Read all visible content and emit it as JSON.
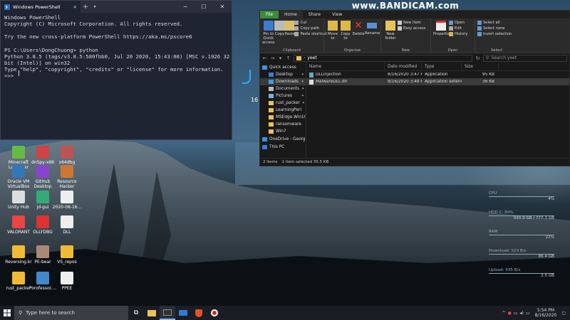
{
  "watermark": {
    "prefix": "www.",
    "brand": "BANDICAM",
    ".suffix": ".com",
    "suffix": ".com"
  },
  "powershell": {
    "tab_title": "Windows PowerShell",
    "new_tab": "+",
    "lines": [
      "Windows PowerShell",
      "Copyright (C) Microsoft Corporation. All rights reserved.",
      "",
      "Try the new cross-platform PowerShell https://aka.ms/pscore6",
      "",
      "PS C:\\Users\\DongChuong> python",
      "Python 3.8.5 (tags/v3.8.5:580fbb0, Jul 20 2020, 15:43:08) [MSC v.1926 32",
      "bit (Intel)] on win32",
      "Type \"help\", \"copyright\", \"credits\" or \"license\" for more information.",
      ">>> "
    ]
  },
  "explorer": {
    "ribbon_tabs": [
      "File",
      "Home",
      "Share",
      "View"
    ],
    "clipboard": {
      "pin": "Pin to Quick access",
      "copy": "Copy",
      "paste": "Paste",
      "cut": "Cut",
      "copy_path": "Copy path",
      "paste_shortcut": "Paste shortcut",
      "label": "Clipboard"
    },
    "organize": {
      "move_to": "Move to",
      "copy_to": "Copy to",
      "delete": "Delete",
      "rename": "Rename",
      "label": "Organize"
    },
    "new": {
      "new_folder": "New folder",
      "new_item": "New item",
      "easy_access": "Easy access",
      "label": "New"
    },
    "open": {
      "properties": "Properties",
      "open": "Open",
      "edit": "Edit",
      "history": "History",
      "label": "Open"
    },
    "select": {
      "select_all": "Select all",
      "select_none": "Select none",
      "invert": "Invert selection",
      "label": "Select"
    },
    "path": "yeet",
    "search_placeholder": "Search yeet",
    "nav": [
      {
        "label": "Quick access",
        "pin": false
      },
      {
        "label": "Desktop",
        "pin": true
      },
      {
        "label": "Downloads",
        "pin": true
      },
      {
        "label": "Documents",
        "pin": true
      },
      {
        "label": "Pictures",
        "pin": true
      },
      {
        "label": "rust_packer",
        "pin": true
      },
      {
        "label": "LearningPerl",
        "pin": false
      },
      {
        "label": "MSEdge.Win10.V",
        "pin": false
      },
      {
        "label": "ransomware",
        "pin": false
      },
      {
        "label": "Win7",
        "pin": false
      },
      {
        "label": "OneDrive - Georg",
        "pin": false
      },
      {
        "label": "This PC",
        "pin": false
      }
    ],
    "columns": [
      "Name",
      "Date modified",
      "Type",
      "Size"
    ],
    "files": [
      {
        "name": "DLLInjection",
        "date": "8/16/2020 3:47 PM",
        "type": "Application",
        "size": "95 KB",
        "selected": false
      },
      {
        "name": "MalwareDLL.dll",
        "date": "8/16/2020 3:49 PM",
        "type": "Application extensi...",
        "size": "36 KB",
        "selected": true
      }
    ],
    "status": {
      "items": "2 items",
      "selected": "1 item selected  35.5 KB"
    }
  },
  "desktop_icons": [
    {
      "label": "Minecraft Launcher",
      "color": "#6b4"
    },
    {
      "label": "dnSpy-x86",
      "color": "#c44"
    },
    {
      "label": "x64dbg",
      "color": "#b55"
    },
    {
      "label": "Oracle VM VirtualBox",
      "color": "#37b"
    },
    {
      "label": "GitHub Desktop",
      "color": "#84c"
    },
    {
      "label": "Resource Hacker",
      "color": "#c73"
    },
    {
      "label": "Unity Hub",
      "color": "#ddd"
    },
    {
      "label": "jd-gui",
      "color": "#3a7"
    },
    {
      "label": "2020-08-16...",
      "color": "#eee"
    },
    {
      "label": "VALORANT",
      "color": "#e44"
    },
    {
      "label": "OLLYDBG",
      "color": "#d33"
    },
    {
      "label": "DLL",
      "color": "#eee"
    },
    {
      "label": "Reversing.kr",
      "color": "#eb3"
    },
    {
      "label": "PE-bear",
      "color": "#a87"
    },
    {
      "label": "VS_repos",
      "color": "#eb3"
    },
    {
      "label": "rust_packer",
      "color": "#eb3"
    },
    {
      "label": "Porofessor....",
      "color": "#48c"
    },
    {
      "label": "PPEE",
      "color": "#eee"
    }
  ],
  "clock_partial": "16",
  "stats": [
    {
      "label": "CPU",
      "value": "4%"
    },
    {
      "label": "HDD C: 84%",
      "value": "930.9 GB / 777.3 GB"
    },
    {
      "label": "RAM",
      "value": "22%"
    },
    {
      "label": "Download: 523 B/s",
      "value": "86.4 GB"
    },
    {
      "label": "Upload: 935 B/s",
      "value": "2.5 GB"
    }
  ],
  "taskbar": {
    "search_placeholder": "Type here to search",
    "time": "5:54 PM",
    "date": "8/16/2020"
  }
}
